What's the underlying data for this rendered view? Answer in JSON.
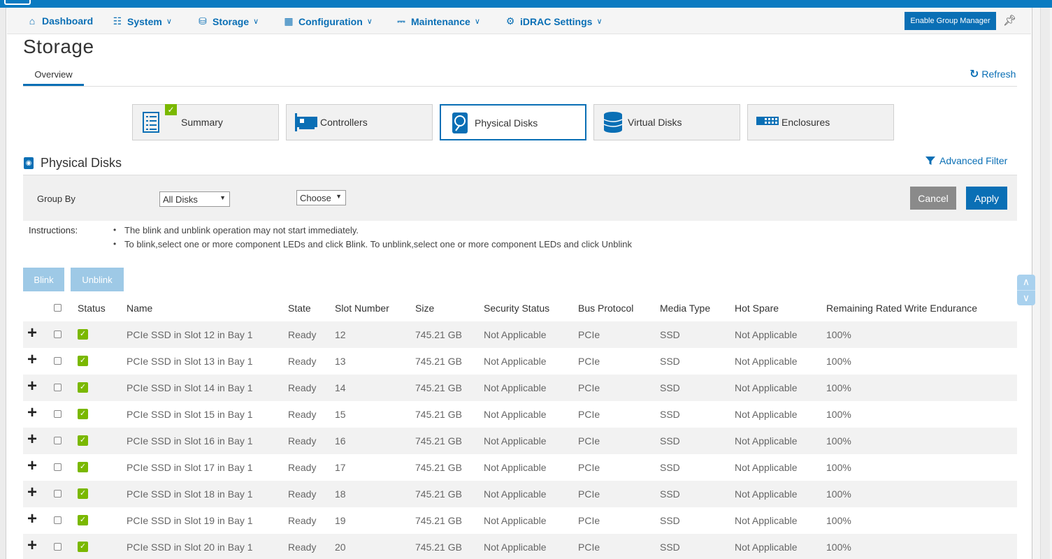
{
  "nav": {
    "items": [
      {
        "label": "Dashboard",
        "icon": "home-icon",
        "glyph": "⌂",
        "chevron": false
      },
      {
        "label": "System",
        "icon": "system-icon",
        "glyph": "☷",
        "chevron": true
      },
      {
        "label": "Storage",
        "icon": "storage-icon",
        "glyph": "⛁",
        "chevron": true
      },
      {
        "label": "Configuration",
        "icon": "configuration-icon",
        "glyph": "▦",
        "chevron": true
      },
      {
        "label": "Maintenance",
        "icon": "maintenance-icon",
        "glyph": "⎓",
        "chevron": true
      },
      {
        "label": "iDRAC Settings",
        "icon": "gears-icon",
        "glyph": "⚙",
        "chevron": true
      }
    ],
    "chevron_glyph": "∨",
    "group_manager_label": "Enable Group Manager"
  },
  "page": {
    "title": "Storage",
    "tab_overview": "Overview",
    "refresh_label": "Refresh"
  },
  "cards": [
    {
      "label": "Summary",
      "icon": "summary-icon",
      "active": false,
      "badge": true
    },
    {
      "label": "Controllers",
      "icon": "controller-icon",
      "active": false,
      "badge": false
    },
    {
      "label": "Physical Disks",
      "icon": "physical-disk-icon",
      "active": true,
      "badge": false
    },
    {
      "label": "Virtual Disks",
      "icon": "virtual-disk-icon",
      "active": false,
      "badge": false
    },
    {
      "label": "Enclosures",
      "icon": "enclosure-icon",
      "active": false,
      "badge": false
    }
  ],
  "section": {
    "title": "Physical Disks",
    "advanced_filter_label": "Advanced Filter"
  },
  "filter": {
    "group_by_label": "Group By",
    "group_by_value": "All Disks",
    "choose_value": "Choose",
    "cancel_label": "Cancel",
    "apply_label": "Apply"
  },
  "instructions": {
    "label": "Instructions:",
    "items": [
      "The blink and unblink operation may not start immediately.",
      "To blink,select one or more component LEDs and click Blink. To unblink,select one or more component LEDs and click Unblink"
    ]
  },
  "actions": {
    "blink_label": "Blink",
    "unblink_label": "Unblink"
  },
  "table": {
    "columns": [
      "Status",
      "Name",
      "State",
      "Slot Number",
      "Size",
      "Security Status",
      "Bus Protocol",
      "Media Type",
      "Hot Spare",
      "Remaining Rated Write Endurance"
    ],
    "rows": [
      {
        "name": "PCIe SSD in Slot 12 in Bay 1",
        "state": "Ready",
        "slot": "12",
        "size": "745.21 GB",
        "security": "Not Applicable",
        "bus": "PCIe",
        "media": "SSD",
        "hotspare": "Not Applicable",
        "endurance": "100%"
      },
      {
        "name": "PCIe SSD in Slot 13 in Bay 1",
        "state": "Ready",
        "slot": "13",
        "size": "745.21 GB",
        "security": "Not Applicable",
        "bus": "PCIe",
        "media": "SSD",
        "hotspare": "Not Applicable",
        "endurance": "100%"
      },
      {
        "name": "PCIe SSD in Slot 14 in Bay 1",
        "state": "Ready",
        "slot": "14",
        "size": "745.21 GB",
        "security": "Not Applicable",
        "bus": "PCIe",
        "media": "SSD",
        "hotspare": "Not Applicable",
        "endurance": "100%"
      },
      {
        "name": "PCIe SSD in Slot 15 in Bay 1",
        "state": "Ready",
        "slot": "15",
        "size": "745.21 GB",
        "security": "Not Applicable",
        "bus": "PCIe",
        "media": "SSD",
        "hotspare": "Not Applicable",
        "endurance": "100%"
      },
      {
        "name": "PCIe SSD in Slot 16 in Bay 1",
        "state": "Ready",
        "slot": "16",
        "size": "745.21 GB",
        "security": "Not Applicable",
        "bus": "PCIe",
        "media": "SSD",
        "hotspare": "Not Applicable",
        "endurance": "100%"
      },
      {
        "name": "PCIe SSD in Slot 17 in Bay 1",
        "state": "Ready",
        "slot": "17",
        "size": "745.21 GB",
        "security": "Not Applicable",
        "bus": "PCIe",
        "media": "SSD",
        "hotspare": "Not Applicable",
        "endurance": "100%"
      },
      {
        "name": "PCIe SSD in Slot 18 in Bay 1",
        "state": "Ready",
        "slot": "18",
        "size": "745.21 GB",
        "security": "Not Applicable",
        "bus": "PCIe",
        "media": "SSD",
        "hotspare": "Not Applicable",
        "endurance": "100%"
      },
      {
        "name": "PCIe SSD in Slot 19 in Bay 1",
        "state": "Ready",
        "slot": "19",
        "size": "745.21 GB",
        "security": "Not Applicable",
        "bus": "PCIe",
        "media": "SSD",
        "hotspare": "Not Applicable",
        "endurance": "100%"
      },
      {
        "name": "PCIe SSD in Slot 20 in Bay 1",
        "state": "Ready",
        "slot": "20",
        "size": "745.21 GB",
        "security": "Not Applicable",
        "bus": "PCIe",
        "media": "SSD",
        "hotspare": "Not Applicable",
        "endurance": "100%"
      }
    ]
  },
  "colors": {
    "accent": "#0a6fb5",
    "status_ok": "#7ab800",
    "button_disabled": "#9ec9e6",
    "button_cancel": "#8a8a8a"
  }
}
